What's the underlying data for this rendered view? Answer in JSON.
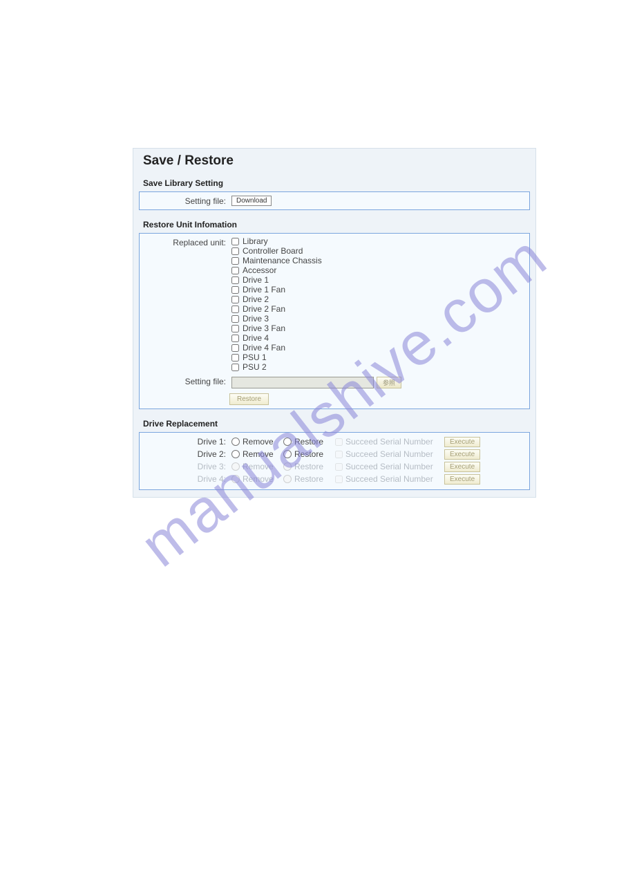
{
  "watermark": "manualshive.com",
  "page_title": "Save / Restore",
  "save_section": {
    "title": "Save Library Setting",
    "label": "Setting file:",
    "download_btn": "Download"
  },
  "restore_section": {
    "title": "Restore Unit Infomation",
    "replaced_label": "Replaced unit:",
    "checkbox_items": [
      "Library",
      "Controller Board",
      "Maintenance Chassis",
      "Accessor",
      "Drive 1",
      "Drive 1 Fan",
      "Drive 2",
      "Drive 2 Fan",
      "Drive 3",
      "Drive 3 Fan",
      "Drive 4",
      "Drive 4 Fan",
      "PSU 1",
      "PSU 2"
    ],
    "setting_file_label": "Setting file:",
    "browse_btn": "参照",
    "restore_btn": "Restore"
  },
  "drive_section": {
    "title": "Drive Replacement",
    "rows": [
      {
        "label": "Drive 1:",
        "remove": "Remove",
        "restore": "Restore",
        "serial": "Succeed Serial Number",
        "execute": "Execute",
        "dimmed": false
      },
      {
        "label": "Drive 2:",
        "remove": "Remove",
        "restore": "Restore",
        "serial": "Succeed Serial Number",
        "execute": "Execute",
        "dimmed": false
      },
      {
        "label": "Drive 3:",
        "remove": "Remove",
        "restore": "Restore",
        "serial": "Succeed Serial Number",
        "execute": "Execute",
        "dimmed": true
      },
      {
        "label": "Drive 4:",
        "remove": "Remove",
        "restore": "Restore",
        "serial": "Succeed Serial Number",
        "execute": "Execute",
        "dimmed": true
      }
    ]
  }
}
